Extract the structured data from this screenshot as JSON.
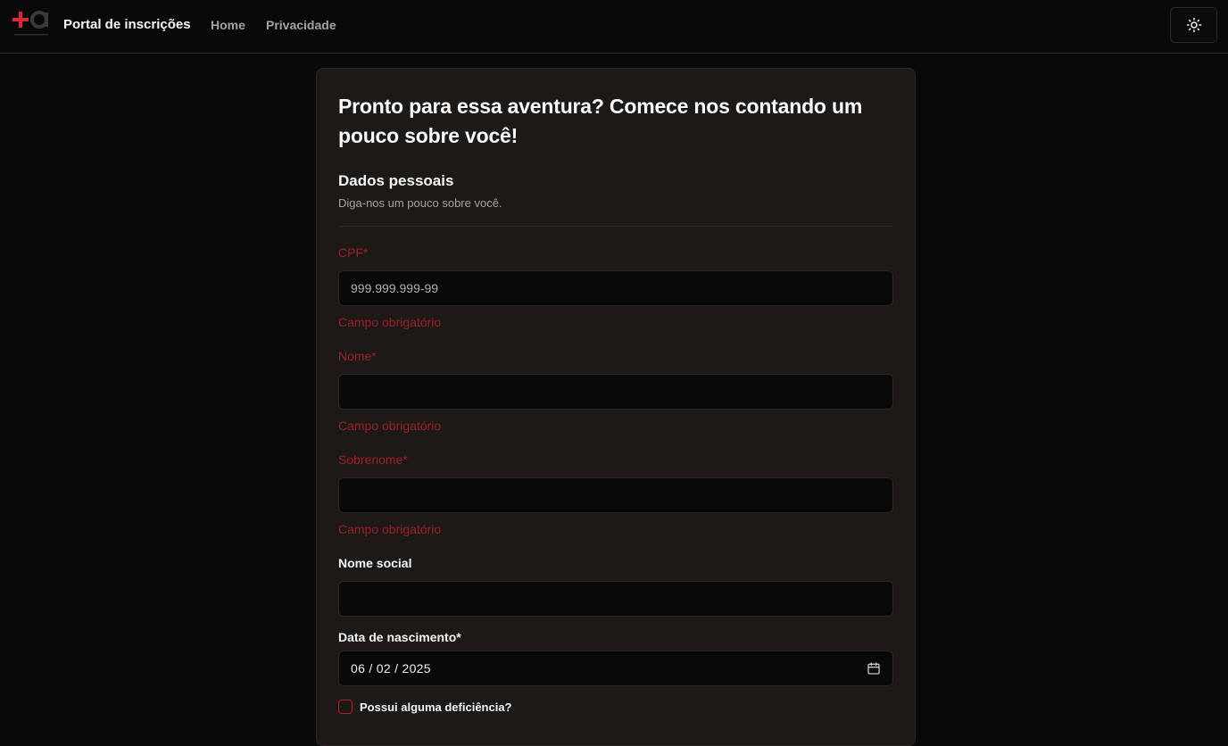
{
  "nav": {
    "brand": "Portal de inscrições",
    "links": [
      "Home",
      "Privacidade"
    ],
    "theme_icon": "sun-icon"
  },
  "colors": {
    "background": "#0a0909",
    "card": "#1c1917",
    "error": "#9f1f2a",
    "logo_red": "#d8263a"
  },
  "form": {
    "title": "Pronto para essa aventura? Comece nos contando um pouco sobre você!",
    "section_title": "Dados pessoais",
    "section_desc": "Diga-nos um pouco sobre você.",
    "cpf": {
      "label": "CPF*",
      "placeholder": "999.999.999-99",
      "value": "",
      "error": "Campo obrigatório"
    },
    "nome": {
      "label": "Nome*",
      "value": "",
      "error": "Campo obrigatório"
    },
    "sobrenome": {
      "label": "Sobrenome*",
      "value": "",
      "error": "Campo obrigatório"
    },
    "nome_social": {
      "label": "Nome social",
      "value": ""
    },
    "nascimento": {
      "label": "Data de nascimento*",
      "value": "06 / 02 / 2025",
      "icon": "calendar-icon"
    },
    "deficiencia": {
      "label": "Possui alguma deficiência?",
      "checked": false
    }
  }
}
